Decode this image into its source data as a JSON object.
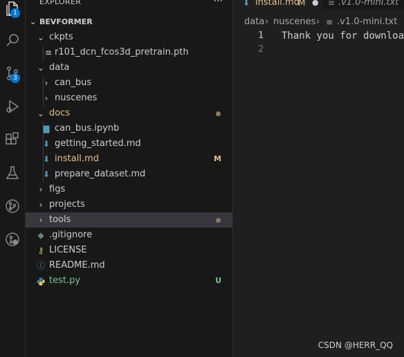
{
  "sidebar": {
    "header": "EXPLORER",
    "more": "···",
    "project": "BEVFORMER",
    "items": [
      {
        "label": "ckpts",
        "type": "folder-open",
        "color": "#cccccc"
      },
      {
        "label": "r101_dcn_fcos3d_pretrain.pth",
        "type": "file",
        "icon": "≡",
        "color": "#cccccc"
      },
      {
        "label": "data",
        "type": "folder-open",
        "color": "#cccccc"
      },
      {
        "label": "can_bus",
        "type": "folder-closed",
        "color": "#cccccc"
      },
      {
        "label": "nuscenes",
        "type": "folder-closed",
        "color": "#cccccc"
      },
      {
        "label": "docs",
        "type": "folder-open",
        "color": "#e2c08d"
      },
      {
        "label": "can_bus.ipynb",
        "type": "file",
        "color": "#cccccc"
      },
      {
        "label": "getting_started.md",
        "type": "file",
        "color": "#cccccc"
      },
      {
        "label": "install.md",
        "type": "file",
        "color": "#e2c08d",
        "decoration": "M"
      },
      {
        "label": "prepare_dataset.md",
        "type": "file",
        "color": "#cccccc"
      },
      {
        "label": "figs",
        "type": "folder-closed",
        "color": "#cccccc"
      },
      {
        "label": "projects",
        "type": "folder-closed",
        "color": "#cccccc"
      },
      {
        "label": "tools",
        "type": "folder-closed",
        "color": "#cccccc"
      },
      {
        "label": ".gitignore",
        "type": "file",
        "color": "#cccccc"
      },
      {
        "label": "LICENSE",
        "type": "file",
        "color": "#cccccc"
      },
      {
        "label": "README.md",
        "type": "file",
        "color": "#cccccc"
      },
      {
        "label": "test.py",
        "type": "file",
        "color": "#73c991",
        "decoration": "U"
      }
    ]
  },
  "activity": {
    "explorer_badge": "1",
    "scm_badge": "3"
  },
  "editor": {
    "tabs": [
      {
        "label": "install.md",
        "decoration": "M"
      },
      {
        "label": ".v1.0-mini.txt"
      }
    ],
    "breadcrumb": [
      "data",
      "nuscenes",
      ".v1.0-mini.txt"
    ],
    "line_numbers": [
      "1",
      "2"
    ],
    "code_line": "Thank you for downloa"
  },
  "watermark": "CSDN @HERR_QQ",
  "colors": {
    "modified": "#e2c08d",
    "untracked": "#73c991",
    "markdown_icon": "#519aba",
    "python_icon": "#4584b6",
    "license_icon": "#cbcb41",
    "badge": "#0078d4"
  }
}
